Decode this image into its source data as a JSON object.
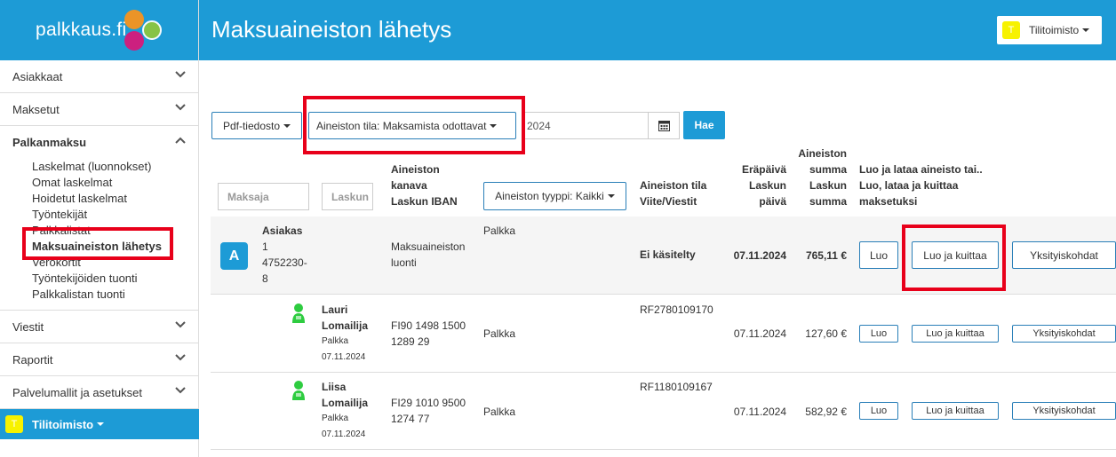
{
  "logo": {
    "text": "palkkaus.fi"
  },
  "header": {
    "title": "Maksuaineiston lähetys",
    "account": "Tilitoimisto",
    "account_badge": "T"
  },
  "sidebar": {
    "sections": {
      "asiakkaat": "Asiakkaat",
      "maksetut": "Maksetut",
      "palkanmaksu": "Palkanmaksu",
      "viestit": "Viestit",
      "raportit": "Raportit",
      "palvelumallit": "Palvelumallit ja asetukset"
    },
    "sub_items": [
      "Laskelmat (luonnokset)",
      "Omat laskelmat",
      "Hoidetut laskelmat",
      "Työntekijät",
      "Palkkalistat",
      "Maksuaineiston lähetys",
      "Verokortit",
      "Työntekijöiden tuonti",
      "Palkkalistan tuonti"
    ],
    "footer_label": "Tilitoimisto",
    "footer_badge": "T"
  },
  "toolbar": {
    "pdf_label": "Pdf-tiedosto",
    "status_label": "Aineiston tila: Maksamista odottavat",
    "date_value": "2024",
    "search_label": "Hae"
  },
  "table": {
    "filters": {
      "payer_placeholder": "Maksaja",
      "invoice_placeholder": "Laskun",
      "type_label": "Aineiston tyyppi: Kaikki"
    },
    "headers": {
      "channel": [
        "Aineiston",
        "kanava",
        "Laskun IBAN"
      ],
      "state": [
        "Aineiston tila",
        "Viite/Viestit"
      ],
      "due": [
        "Eräpäivä",
        "Laskun",
        "päivä"
      ],
      "sum": [
        "Aineiston",
        "summa",
        "Laskun",
        "summa"
      ],
      "actions": [
        "Luo ja lataa aineisto tai..",
        "Luo, lataa ja kuittaa",
        "maksetuksi"
      ]
    },
    "group": {
      "avatar": "A",
      "client_lines": [
        "Asiakas",
        "1",
        "4752230-",
        "8"
      ],
      "channel_lines": [
        "Maksuaineiston",
        "luonti"
      ],
      "type": "Palkka",
      "state": "Ei käsitelty",
      "due": "07.11.2024",
      "sum": "765,11 €",
      "actions": {
        "create": "Luo",
        "create_confirm": "Luo ja kuittaa",
        "details": "Yksityiskohdat"
      }
    },
    "rows": [
      {
        "name_lines": [
          "Lauri",
          "Lomailija"
        ],
        "sub_type": "Palkka",
        "sub_date": "07.11.2024",
        "iban_lines": [
          "FI90 1498 1500",
          "1289 29"
        ],
        "type": "Palkka",
        "ref": "RF2780109170",
        "due": "07.11.2024",
        "sum": "127,60 €",
        "actions": {
          "create": "Luo",
          "create_confirm": "Luo ja kuittaa",
          "details": "Yksityiskohdat"
        }
      },
      {
        "name_lines": [
          "Liisa",
          "Lomailija"
        ],
        "sub_type": "Palkka",
        "sub_date": "07.11.2024",
        "iban_lines": [
          "FI29 1010 9500",
          "1274 77"
        ],
        "type": "Palkka",
        "ref": "RF1180109167",
        "due": "07.11.2024",
        "sum": "582,92 €",
        "actions": {
          "create": "Luo",
          "create_confirm": "Luo ja kuittaa",
          "details": "Yksityiskohdat"
        }
      }
    ]
  },
  "icons": {
    "calendar": "calendar-icon",
    "chevron": "chevron-icon",
    "person": "person-icon"
  },
  "colors": {
    "brand": "#1d9bd6",
    "highlight": "#e8001a",
    "badge": "#f7f200",
    "person": "#2ecc40"
  }
}
